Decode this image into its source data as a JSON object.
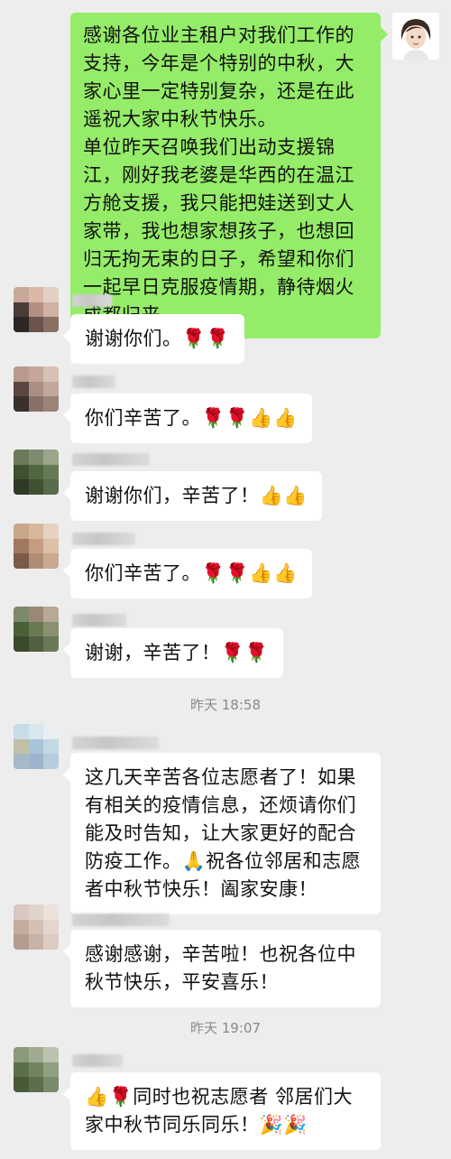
{
  "messages": [
    {
      "sender": "self",
      "text": "感谢各位业主租户对我们工作的支持，今年是个特别的中秋，大家心里一定特别复杂，还是在此遥祝大家中秋节快乐。\n单位昨天召唤我们出动支援锦江，刚好我老婆是华西的在温江方舱支援，我只能把娃送到丈人家带，我也想家想孩子，也想回归无拘无束的日子，希望和你们一起早日克服疫情期，静待烟火成都归来。"
    },
    {
      "sender": "other",
      "text": "谢谢你们。🌹🌹"
    },
    {
      "sender": "other",
      "text": "你们辛苦了。🌹🌹👍👍"
    },
    {
      "sender": "other",
      "text": "谢谢你们，辛苦了！👍👍"
    },
    {
      "sender": "other",
      "text": "你们辛苦了。🌹🌹👍👍"
    },
    {
      "sender": "other",
      "text": "谢谢，辛苦了！🌹🌹"
    },
    {
      "sender": "other",
      "text": "这几天辛苦各位志愿者了！如果有相关的疫情信息，还烦请你们能及时告知，让大家更好的配合防疫工作。🙏祝各位邻居和志愿者中秋节快乐！阖家安康！"
    },
    {
      "sender": "other",
      "text": "感谢感谢，辛苦啦！也祝各位中秋节快乐，平安喜乐！"
    },
    {
      "sender": "other",
      "text": "👍🌹同时也祝志愿者 邻居们大家中秋节同乐同乐！🎉🎉"
    }
  ],
  "timestamps": [
    "昨天 18:58",
    "昨天 19:07"
  ],
  "colors": {
    "background": "#ededed",
    "self_bubble": "#95ec69",
    "other_bubble": "#ffffff",
    "timestamp_text": "#8a8a8a"
  },
  "icons": [
    "avatar-cartoon-woman",
    "avatar-pixelated"
  ]
}
